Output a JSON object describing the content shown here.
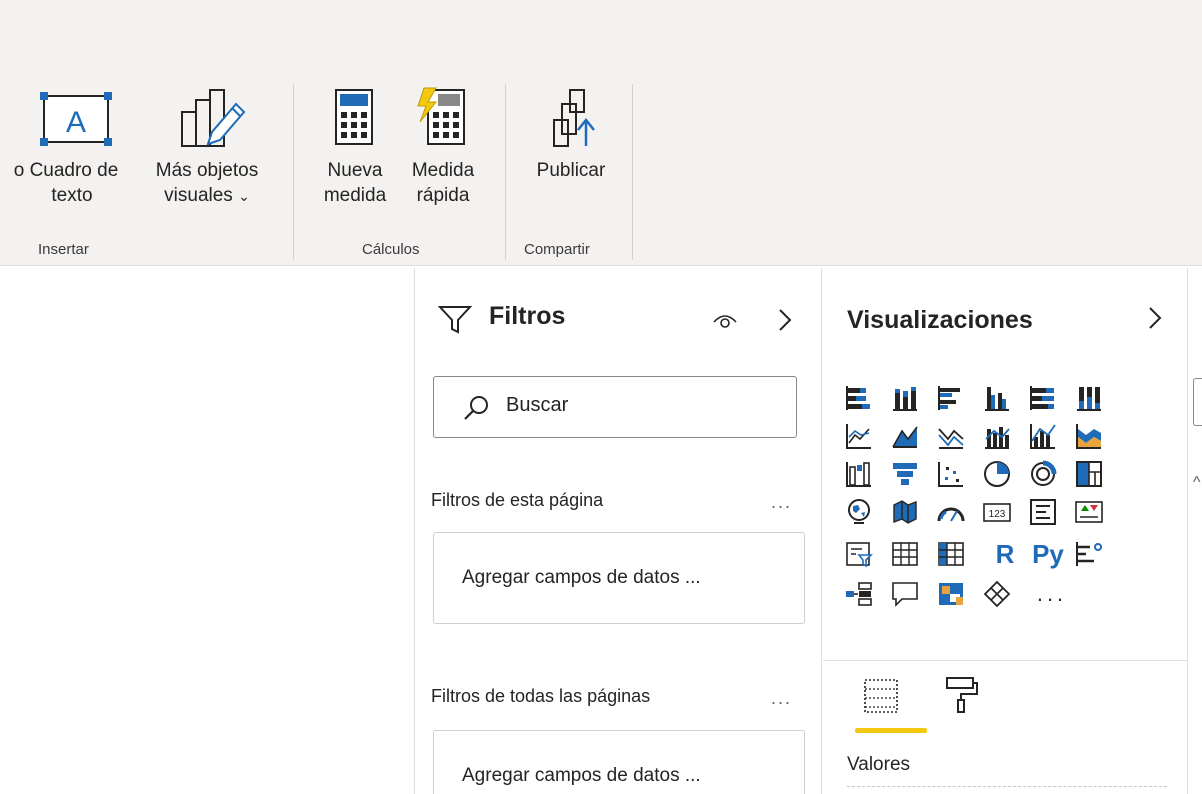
{
  "ribbon": {
    "cuadro_texto": {
      "line1": "Cuadro de",
      "line2": "texto",
      "prefix": "o"
    },
    "mas_objetos": {
      "line1": "Más objetos",
      "line2": "visuales"
    },
    "nueva_medida": {
      "line1": "Nueva",
      "line2": "medida"
    },
    "medida_rapida": {
      "line1": "Medida",
      "line2": "rápida"
    },
    "publicar": {
      "line1": "Publicar"
    },
    "groups": {
      "insertar": "Insertar",
      "calculos": "Cálculos",
      "compartir": "Compartir"
    }
  },
  "filters": {
    "title": "Filtros",
    "search_placeholder": "Buscar",
    "this_page": "Filtros de esta página",
    "all_pages": "Filtros de todas las páginas",
    "more": "...",
    "add_fields": "Agregar campos de datos ..."
  },
  "visualizations": {
    "title": "Visualizaciones",
    "r_label": "R",
    "py_label": "Py",
    "more": "...",
    "kpi_number": "123",
    "valores_label": "Valores"
  },
  "colors": {
    "accent_blue": "#1f6bb8",
    "accent_yellow": "#f2c811",
    "highlight": "#fff600"
  }
}
